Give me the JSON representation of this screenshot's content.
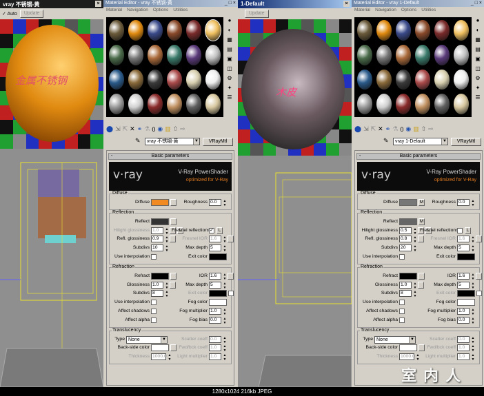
{
  "render_windows": [
    {
      "title": "vray 不锈钢-黄",
      "auto_label": "Auto",
      "update_label": "Update",
      "overlay_text": "金属不锈钢"
    },
    {
      "title": "1-Default",
      "update_label": "Update",
      "overlay_text": "木皮"
    }
  ],
  "editors": [
    {
      "title": "Material Editor - vray 不锈钢-黄",
      "menu": [
        "Material",
        "Navigation",
        "Options",
        "Utilities"
      ],
      "material_name": "vray 不锈钢-黄",
      "material_type": "VRayMtl",
      "rollout_title": "Basic parameters",
      "logo": {
        "brand": "v·ray",
        "line1": "V-Ray PowerShader",
        "line2": "optimized for V-Ray"
      },
      "groups": [
        {
          "title": "Diffuse",
          "rows": [
            {
              "l": {
                "label": "Diffuse",
                "kind": "color",
                "color": "#f28a22",
                "btn": ""
              },
              "r": {
                "label": "Roughness",
                "kind": "spin",
                "value": "0.0"
              }
            }
          ]
        },
        {
          "title": "Reflection",
          "rows": [
            {
              "l": {
                "label": "Reflect",
                "kind": "color",
                "color": "#333333",
                "btn": ""
              }
            },
            {
              "l": {
                "label": "Hilight glossiness",
                "kind": "spin",
                "value": "1.0",
                "dim": true,
                "btn": "",
                "btn2": "L"
              },
              "r": {
                "label": "Fresnel reflections",
                "kind": "check",
                "checked": "✓",
                "btn": "L"
              }
            },
            {
              "l": {
                "label": "Refl. glossiness",
                "kind": "spin",
                "value": "0.9",
                "btn": ""
              },
              "r": {
                "label": "Fresnel IOR",
                "kind": "spin",
                "value": "1.6",
                "dim": true,
                "btn": ""
              }
            },
            {
              "l": {
                "label": "Subdivs",
                "kind": "spin",
                "value": "10"
              },
              "r": {
                "label": "Max depth",
                "kind": "spin",
                "value": "5"
              }
            },
            {
              "l": {
                "label": "Use interpolation",
                "kind": "check",
                "checked": ""
              },
              "r": {
                "label": "Exit color",
                "kind": "color",
                "color": "#000000"
              }
            }
          ]
        },
        {
          "title": "Refraction",
          "rows": [
            {
              "l": {
                "label": "Refract",
                "kind": "color",
                "color": "#000000",
                "btn": ""
              },
              "r": {
                "label": "IOR",
                "kind": "spin",
                "value": "1.6",
                "btn": ""
              }
            },
            {
              "l": {
                "label": "Glossiness",
                "kind": "spin",
                "value": "1.0",
                "btn": ""
              },
              "r": {
                "label": "Max depth",
                "kind": "spin",
                "value": "5"
              }
            },
            {
              "l": {
                "label": "Subdivs",
                "kind": "spin",
                "value": "8"
              },
              "r": {
                "label": "Exit color",
                "kind": "color",
                "color": "#000000",
                "dim": true,
                "chk": true
              }
            },
            {
              "l": {
                "label": "Use interpolation",
                "kind": "check",
                "checked": ""
              },
              "r": {
                "label": "Fog color",
                "kind": "color",
                "color": "#ffffff"
              }
            },
            {
              "l": {
                "label": "Affect shadows",
                "kind": "check",
                "checked": ""
              },
              "r": {
                "label": "Fog multiplier",
                "kind": "spin",
                "value": "1.0"
              }
            },
            {
              "l": {
                "label": "Affect alpha",
                "kind": "check",
                "checked": ""
              },
              "r": {
                "label": "Fog bias",
                "kind": "spin",
                "value": "0.0"
              }
            }
          ]
        },
        {
          "title": "Translucency",
          "rows": [
            {
              "l": {
                "label": "Type",
                "kind": "select",
                "value": "None"
              },
              "r": {
                "label": "Scatter coeff",
                "kind": "spin",
                "value": "0.0",
                "dim": true
              }
            },
            {
              "l": {
                "label": "Back-side color",
                "kind": "color",
                "color": "#ffffff",
                "btn": ""
              },
              "r": {
                "label": "Fwd/bck coeff",
                "kind": "spin",
                "value": "1.0",
                "dim": true
              }
            },
            {
              "l": {
                "label": "Thickness",
                "kind": "spin",
                "value": "1000.0",
                "dim": true
              },
              "r": {
                "label": "Light multiplier",
                "kind": "spin",
                "value": "1.0",
                "dim": true
              }
            }
          ]
        }
      ]
    },
    {
      "title": "Material Editor - vray 1-Default",
      "menu": [
        "Material",
        "Navigation",
        "Options",
        "Utilities"
      ],
      "material_name": "vray 1-Default",
      "material_type": "VRayMtl",
      "rollout_title": "Basic parameters",
      "logo": {
        "brand": "v·ray",
        "line1": "V-Ray PowerShader",
        "line2": "optimized for V-Ray"
      },
      "groups": [
        {
          "title": "Diffuse",
          "rows": [
            {
              "l": {
                "label": "Diffuse",
                "kind": "color",
                "color": "#777777",
                "btn": "M"
              },
              "r": {
                "label": "Roughness",
                "kind": "spin",
                "value": "0.0"
              }
            }
          ]
        },
        {
          "title": "Reflection",
          "rows": [
            {
              "l": {
                "label": "Reflect",
                "kind": "color",
                "color": "#666666",
                "btn": "M"
              }
            },
            {
              "l": {
                "label": "Hilight glossiness",
                "kind": "spin",
                "value": "0.5",
                "btn": "",
                "btn2": "L"
              },
              "r": {
                "label": "Fresnel reflections",
                "kind": "check",
                "checked": "",
                "btn": "L"
              }
            },
            {
              "l": {
                "label": "Refl. glossiness",
                "kind": "spin",
                "value": "0.8",
                "btn": ""
              },
              "r": {
                "label": "Fresnel IOR",
                "kind": "spin",
                "value": "1.6",
                "dim": true,
                "btn": ""
              }
            },
            {
              "l": {
                "label": "Subdivs",
                "kind": "spin",
                "value": "20"
              },
              "r": {
                "label": "Max depth",
                "kind": "spin",
                "value": "5"
              }
            },
            {
              "l": {
                "label": "Use interpolation",
                "kind": "check",
                "checked": ""
              },
              "r": {
                "label": "Exit color",
                "kind": "color",
                "color": "#000000"
              }
            }
          ]
        },
        {
          "title": "Refraction",
          "rows": [
            {
              "l": {
                "label": "Refract",
                "kind": "color",
                "color": "#000000",
                "btn": ""
              },
              "r": {
                "label": "IOR",
                "kind": "spin",
                "value": "1.6",
                "btn": ""
              }
            },
            {
              "l": {
                "label": "Glossiness",
                "kind": "spin",
                "value": "1.0",
                "btn": ""
              },
              "r": {
                "label": "Max depth",
                "kind": "spin",
                "value": "5"
              }
            },
            {
              "l": {
                "label": "Subdivs",
                "kind": "spin",
                "value": "8"
              },
              "r": {
                "label": "Exit color",
                "kind": "color",
                "color": "#000000",
                "dim": true,
                "chk": true
              }
            },
            {
              "l": {
                "label": "Use interpolation",
                "kind": "check",
                "checked": ""
              },
              "r": {
                "label": "Fog color",
                "kind": "color",
                "color": "#ffffff"
              }
            },
            {
              "l": {
                "label": "Affect shadows",
                "kind": "check",
                "checked": ""
              },
              "r": {
                "label": "Fog multiplier",
                "kind": "spin",
                "value": "1.0"
              }
            },
            {
              "l": {
                "label": "Affect alpha",
                "kind": "check",
                "checked": ""
              },
              "r": {
                "label": "Fog bias",
                "kind": "spin",
                "value": "0.0"
              }
            }
          ]
        },
        {
          "title": "Translucency",
          "rows": [
            {
              "l": {
                "label": "Type",
                "kind": "select",
                "value": "None"
              },
              "r": {
                "label": "Scatter coeff",
                "kind": "spin",
                "value": "0.0",
                "dim": true
              }
            },
            {
              "l": {
                "label": "Back-side color",
                "kind": "color",
                "color": "#ffffff",
                "btn": ""
              },
              "r": {
                "label": "Fwd/bck coeff",
                "kind": "spin",
                "value": "1.0",
                "dim": true
              }
            },
            {
              "l": {
                "label": "Thickness",
                "kind": "spin",
                "value": "1000.0",
                "dim": true
              },
              "r": {
                "label": "Light multiplier",
                "kind": "spin",
                "value": "1.0",
                "dim": true
              }
            }
          ]
        }
      ]
    }
  ],
  "watermark": "室内人",
  "status_text": "1280x1024  216kb  JPEG"
}
